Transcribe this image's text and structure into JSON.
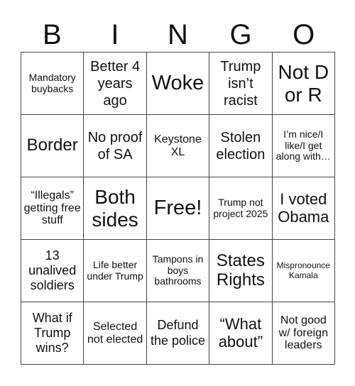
{
  "header": [
    "B",
    "I",
    "N",
    "G",
    "O"
  ],
  "cells": [
    [
      "Mandatory buybacks",
      "Better 4 years ago",
      "Woke",
      "Trump isn’t racist",
      "Not D or R"
    ],
    [
      "Border",
      "No proof of SA",
      "Keystone XL",
      "Stolen election",
      "I’m nice/I like/I get along with…"
    ],
    [
      "“Illegals” getting free stuff",
      "Both sides",
      "Free!",
      "Trump not project 2025",
      "I voted Obama"
    ],
    [
      "13 unalived soldiers",
      "Life better under Trump",
      "Tampons in boys bathrooms",
      "States Rights",
      "Mispronounce Kamala"
    ],
    [
      "What if Trump wins?",
      "Selected not elected",
      "Defund the police",
      "“What about”",
      "Not good w/ foreign leaders"
    ]
  ]
}
